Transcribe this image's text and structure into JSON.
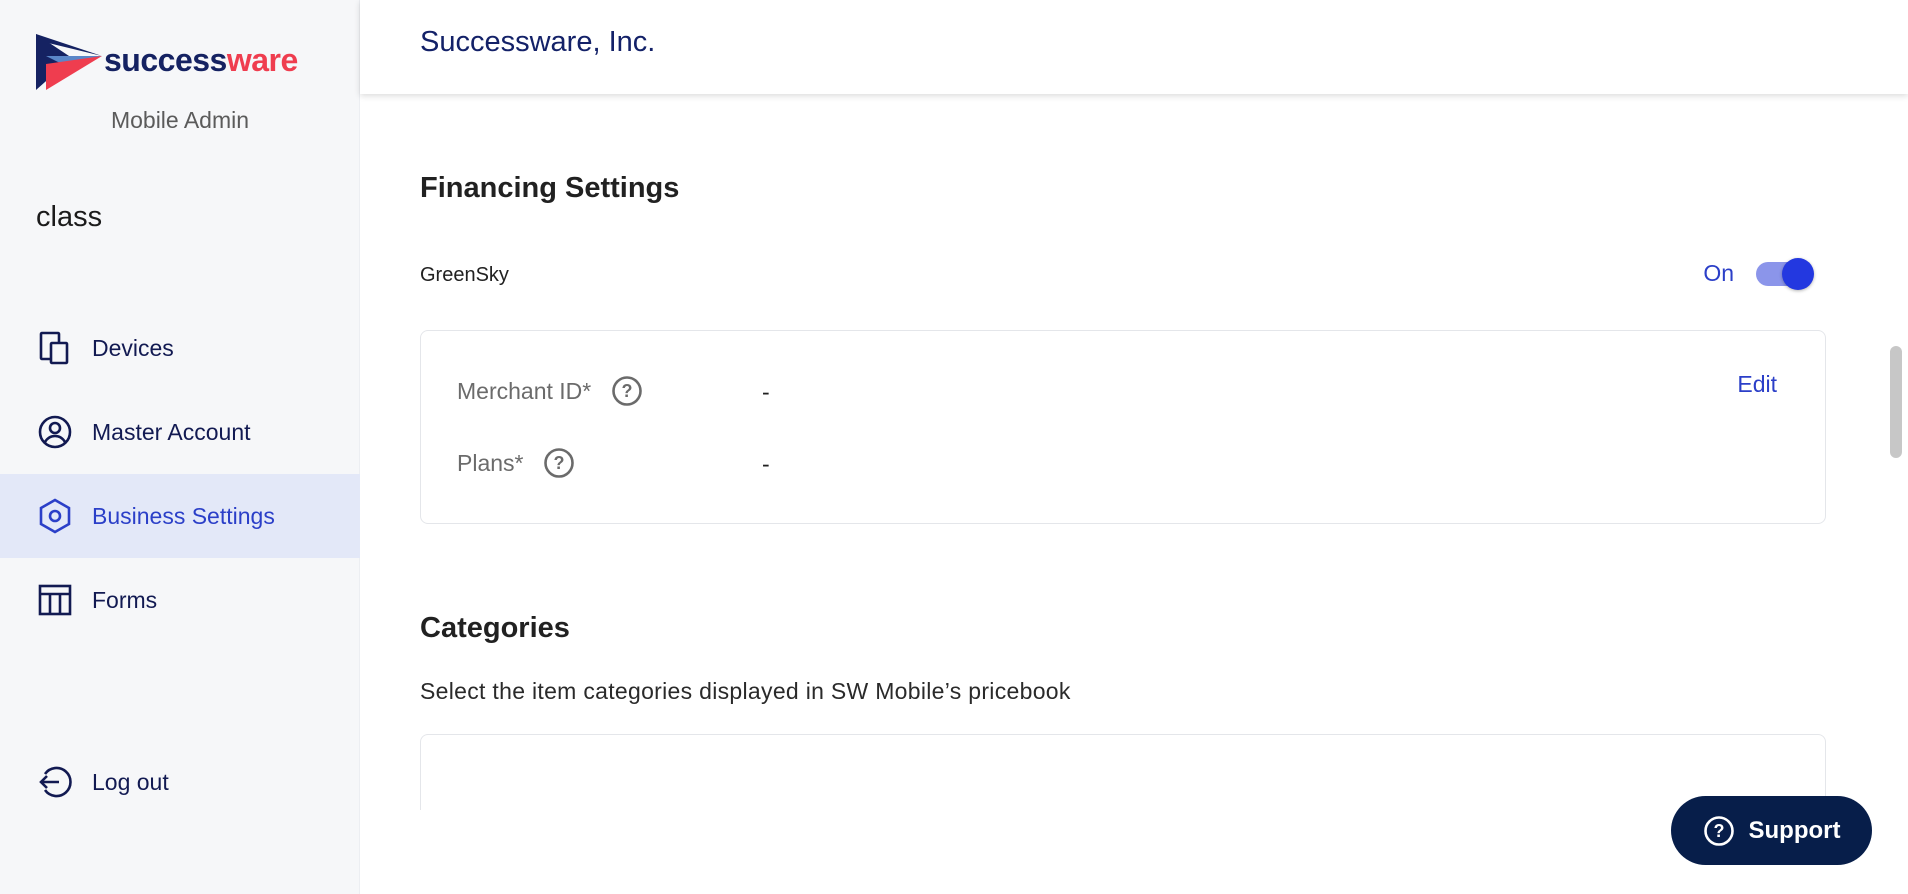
{
  "brand": {
    "logo_text_a": "success",
    "logo_text_b": "ware",
    "subtitle": "Mobile Admin",
    "primary_color": "#152262",
    "accent_color": "#ef3d4f"
  },
  "sidebar": {
    "org_name": "class",
    "items": [
      {
        "label": "Devices",
        "icon": "devices-icon",
        "active": false
      },
      {
        "label": "Master Account",
        "icon": "account-circle-icon",
        "active": false
      },
      {
        "label": "Business Settings",
        "icon": "settings-hexagon-icon",
        "active": true
      },
      {
        "label": "Forms",
        "icon": "table-icon",
        "active": false
      }
    ],
    "logout_label": "Log out"
  },
  "header": {
    "title": "Successware, Inc."
  },
  "financing": {
    "title": "Financing Settings",
    "provider": "GreenSky",
    "toggle_label": "On",
    "toggle_on": true,
    "fields": [
      {
        "label": "Merchant ID*",
        "value": "-"
      },
      {
        "label": "Plans*",
        "value": "-"
      }
    ],
    "edit_label": "Edit"
  },
  "categories": {
    "title": "Categories",
    "description": "Select the item categories displayed in SW Mobile’s pricebook"
  },
  "support": {
    "label": "Support"
  },
  "colors": {
    "active_nav_bg": "#e3e8f8",
    "link": "#2b3fc8",
    "support_bg": "#071e4a"
  }
}
